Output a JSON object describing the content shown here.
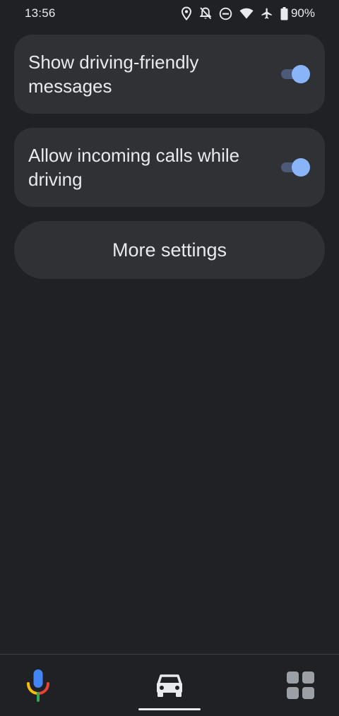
{
  "status_bar": {
    "time": "13:56",
    "battery": "90%",
    "icons": [
      "location-icon",
      "notifications-off-icon",
      "do-not-disturb-icon",
      "wifi-icon",
      "airplane-mode-icon",
      "battery-icon"
    ]
  },
  "settings": {
    "items": [
      {
        "label": "Show driving-friendly messages",
        "enabled": true
      },
      {
        "label": "Allow incoming calls while driving",
        "enabled": true
      }
    ],
    "more_settings_label": "More settings"
  },
  "bottom_nav": {
    "items": [
      "microphone-icon",
      "car-icon",
      "apps-grid-icon"
    ],
    "active": "car-icon"
  },
  "colors": {
    "background": "#202124",
    "card": "#303134",
    "toggle_thumb": "#8ab4f8",
    "toggle_track": "#4a5a78",
    "text": "#e8eaed"
  }
}
